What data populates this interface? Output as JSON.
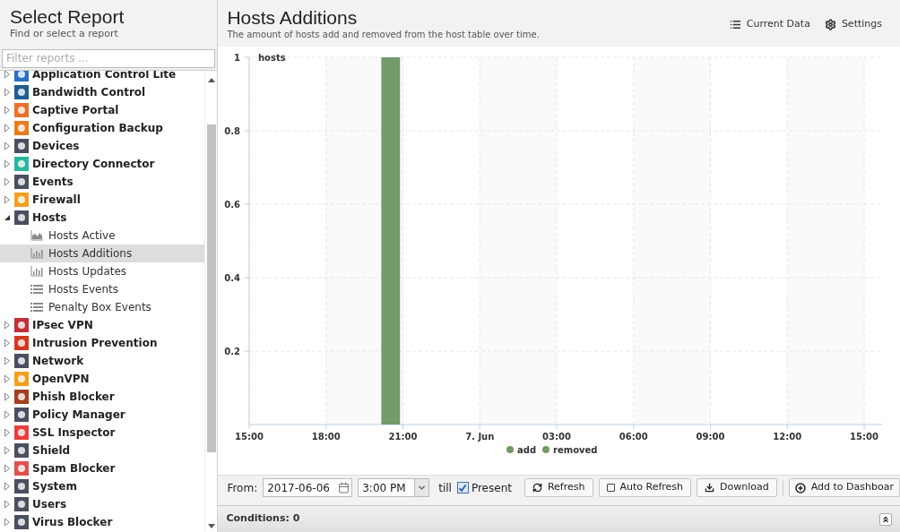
{
  "sidebar": {
    "title": "Select Report",
    "subtitle": "Find or select a report",
    "filter": {
      "placeholder": "Filter reports ..."
    },
    "items": [
      {
        "label": "Application Control Lite",
        "expanded": false
      },
      {
        "label": "Bandwidth Control",
        "expanded": false
      },
      {
        "label": "Captive Portal",
        "expanded": false
      },
      {
        "label": "Configuration Backup",
        "expanded": false
      },
      {
        "label": "Devices",
        "expanded": false
      },
      {
        "label": "Directory Connector",
        "expanded": false
      },
      {
        "label": "Events",
        "expanded": false
      },
      {
        "label": "Firewall",
        "expanded": false
      },
      {
        "label": "Hosts",
        "expanded": true,
        "children": [
          {
            "label": "Hosts Active",
            "kind": "area",
            "selected": false
          },
          {
            "label": "Hosts Additions",
            "kind": "bar",
            "selected": true
          },
          {
            "label": "Hosts Updates",
            "kind": "bar",
            "selected": false
          },
          {
            "label": "Hosts Events",
            "kind": "list",
            "selected": false
          },
          {
            "label": "Penalty Box Events",
            "kind": "list",
            "selected": false
          }
        ]
      },
      {
        "label": "IPsec VPN",
        "expanded": false
      },
      {
        "label": "Intrusion Prevention",
        "expanded": false
      },
      {
        "label": "Network",
        "expanded": false
      },
      {
        "label": "OpenVPN",
        "expanded": false
      },
      {
        "label": "Phish Blocker",
        "expanded": false
      },
      {
        "label": "Policy Manager",
        "expanded": false
      },
      {
        "label": "SSL Inspector",
        "expanded": false
      },
      {
        "label": "Shield",
        "expanded": false
      },
      {
        "label": "Spam Blocker",
        "expanded": false
      },
      {
        "label": "System",
        "expanded": false
      },
      {
        "label": "Users",
        "expanded": false
      },
      {
        "label": "Virus Blocker",
        "expanded": false
      }
    ]
  },
  "report": {
    "title": "Hosts Additions",
    "description": "The amount of hosts add and removed from the host table over time.",
    "actions": [
      {
        "label": "Current Data",
        "kind": "table"
      },
      {
        "label": "Settings",
        "kind": "gear"
      }
    ],
    "chart_data": {
      "type": "bar",
      "ylabel": "hosts",
      "ylim": [
        0,
        1
      ],
      "categories": [
        "15:00",
        null,
        null,
        "18:00",
        null,
        null,
        "21:00",
        null,
        null,
        "7. Jun",
        null,
        null,
        "03:00",
        null,
        null,
        "06:00",
        null,
        null,
        "09:00",
        null,
        null,
        "12:00",
        null,
        null,
        "15:00"
      ],
      "yticks": [
        0.2,
        0.4,
        0.6,
        0.8,
        1
      ],
      "stacked": true,
      "grid": true,
      "series": [
        {
          "name": "add",
          "color": "#74996a",
          "values": [
            0,
            0,
            0,
            0,
            0,
            1,
            0,
            0,
            0,
            0,
            0,
            0,
            0,
            0,
            0,
            0,
            0,
            0,
            0,
            0,
            0,
            0,
            0,
            0,
            0
          ]
        },
        {
          "name": "removed",
          "color": "#74996a",
          "values": [
            0,
            0,
            0,
            0,
            0,
            0,
            0,
            0,
            0,
            0,
            0,
            0,
            0,
            0,
            0,
            0,
            0,
            0,
            0,
            0,
            0,
            0,
            0,
            0,
            0
          ]
        }
      ]
    }
  },
  "toolbar": {
    "from_label": "From:",
    "date": "2017-06-06",
    "time": "3:00 PM",
    "till_label": "till",
    "present": {
      "label": "Present",
      "checked": true
    },
    "refresh": "Refresh",
    "auto_refresh": {
      "label": "Auto Refresh",
      "checked": false
    },
    "download": "Download",
    "add_to_dashboard": "Add to Dashboar"
  },
  "conditions": "Conditions: 0"
}
